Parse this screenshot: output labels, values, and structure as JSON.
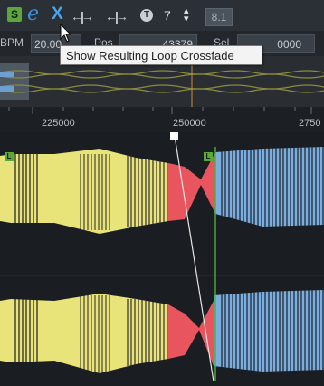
{
  "toolbar": {
    "s_label": "S",
    "e_label": "e",
    "x_label": "X",
    "value": "7",
    "stepper_glyph": "▴▾",
    "version": "8.1",
    "loop_glyph": "T",
    "arrow_glyphs": [
      "←|→",
      "←|→"
    ]
  },
  "row2": {
    "bpm_label": "BPM",
    "bpm_value": "20.00",
    "pos_label": "Pos",
    "pos_value": "43379",
    "sel_label": "Sel",
    "sel_value": "0000"
  },
  "tooltip": {
    "text": "Show Resulting Loop Crossfade"
  },
  "ruler": {
    "ticks": [
      "225000",
      "250000",
      "2750"
    ]
  },
  "markers": {
    "left_loop": "L",
    "right_loop": "L"
  },
  "colors": {
    "loop_region": "#e8e47a",
    "crossfade": "#e8555f",
    "after_loop": "#7aaee0",
    "cursor": "#4caf3c",
    "overview_wave": "#8a8a3c"
  }
}
